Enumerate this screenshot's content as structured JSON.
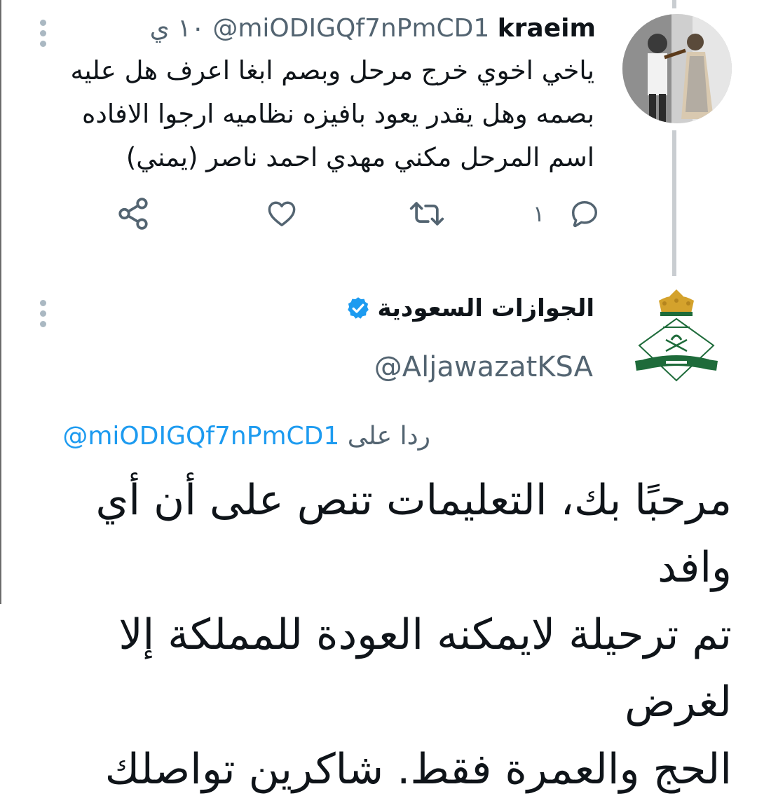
{
  "tweet1": {
    "display_name": "kraeim",
    "handle": "@miODIGQf7nPmCD1",
    "time": "١٠ ي",
    "body": "ياخي اخوي خرج مرحل وبصم ابغا اعرف هل عليه\nبصمه وهل يقدر يعود بافيزه نظاميه ارجوا الافاده\nاسم المرحل مكني مهدي احمد ناصر (يمني)",
    "reply_count": "١",
    "icons": [
      "more-vertical-icon",
      "reply-icon",
      "retweet-icon",
      "like-icon",
      "share-icon"
    ]
  },
  "tweet2": {
    "display_name": "الجوازات السعودية",
    "handle": "@AljawazatKSA",
    "reply_label": "ردا على",
    "reply_mention": "@miODIGQf7nPmCD1",
    "body": "مرحبًا بك، التعليمات تنص على أن أي وافد\nتم ترحيلة لايمكنه العودة للمملكة إلا لغرض\nالحج والعمرة فقط. شاكرين تواصلك",
    "icons": [
      "more-vertical-icon",
      "verified-badge-icon"
    ]
  },
  "colors": {
    "text": "#0f1419",
    "secondary": "#536471",
    "accent": "#1d9bf0",
    "thread_line": "#c9cdd1",
    "emblem_green": "#1e6b3a",
    "emblem_gold": "#d4a22c"
  }
}
